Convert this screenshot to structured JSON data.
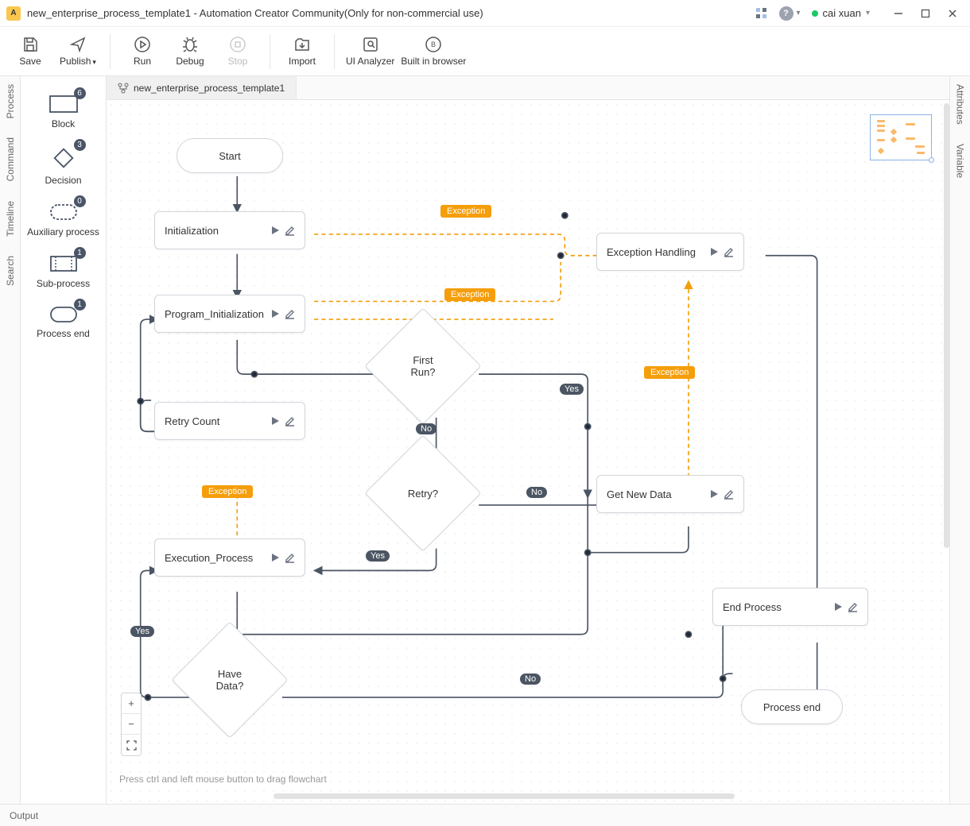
{
  "window": {
    "title": "new_enterprise_process_template1 - Automation Creator Community(Only for non-commercial use)",
    "user": "cai xuan"
  },
  "toolbar": {
    "save": "Save",
    "publish": "Publish",
    "run": "Run",
    "debug": "Debug",
    "stop": "Stop",
    "import": "Import",
    "ui_analyzer": "UI Analyzer",
    "browser": "Built in browser"
  },
  "left_tabs": {
    "process": "Process",
    "command": "Command",
    "timeline": "Timeline",
    "search": "Search"
  },
  "right_tabs": {
    "attributes": "Attributes",
    "variable": "Variable"
  },
  "palette": {
    "block": {
      "label": "Block",
      "badge": "6"
    },
    "decision": {
      "label": "Decision",
      "badge": "3"
    },
    "aux": {
      "label": "Auxiliary process",
      "badge": "0"
    },
    "sub": {
      "label": "Sub-process",
      "badge": "1"
    },
    "end": {
      "label": "Process end",
      "badge": "1"
    }
  },
  "doc_tab": "new_enterprise_process_template1",
  "nodes": {
    "start": "Start",
    "init": "Initialization",
    "prog_init": "Program_Initialization",
    "retry_count": "Retry Count",
    "exec": "Execution_Process",
    "first_run": "First\nRun?",
    "retry": "Retry?",
    "have_data": "Have\nData?",
    "exc_handling": "Exception Handling",
    "get_data": "Get New Data",
    "end_proc": "End Process",
    "proc_end": "Process end"
  },
  "edges": {
    "yes": "Yes",
    "no": "No",
    "exception": "Exception"
  },
  "hint": "Press ctrl and left mouse button to drag flowchart",
  "status": {
    "output": "Output"
  }
}
